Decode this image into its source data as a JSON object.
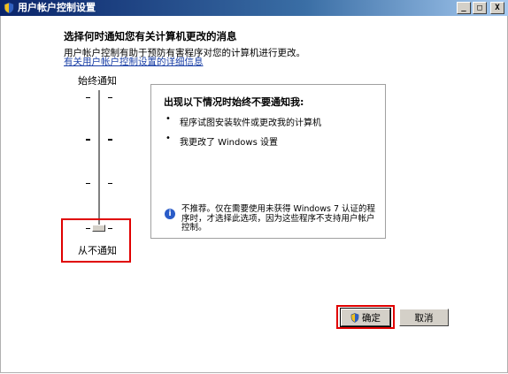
{
  "window": {
    "title": "用户帐户控制设置",
    "controls": {
      "minimize": "_",
      "maximize": "□",
      "close": "X"
    }
  },
  "main": {
    "heading": "选择何时通知您有关计算机更改的消息",
    "description": "用户帐户控制有助于预防有害程序对您的计算机进行更改。",
    "link": "有关用户帐户控制设置的详细信息"
  },
  "slider": {
    "top_label": "始终通知",
    "bottom_label": "从不通知",
    "levels": 4,
    "selected_level": 1
  },
  "panel": {
    "title": "出现以下情况时始终不要通知我:",
    "bullets": [
      "程序试图安装软件或更改我的计算机",
      "我更改了 Windows 设置"
    ],
    "bullet_glyph": "•",
    "info_icon": "i",
    "note": "不推荐。仅在需要使用未获得 Windows 7 认证的程序时，才选择此选项，因为这些程序不支持用户帐户控制。"
  },
  "buttons": {
    "ok": "确定",
    "cancel": "取消"
  },
  "colors": {
    "highlight": "#e00000",
    "titlebar": "#0a246a",
    "link": "#1a3fa6"
  }
}
